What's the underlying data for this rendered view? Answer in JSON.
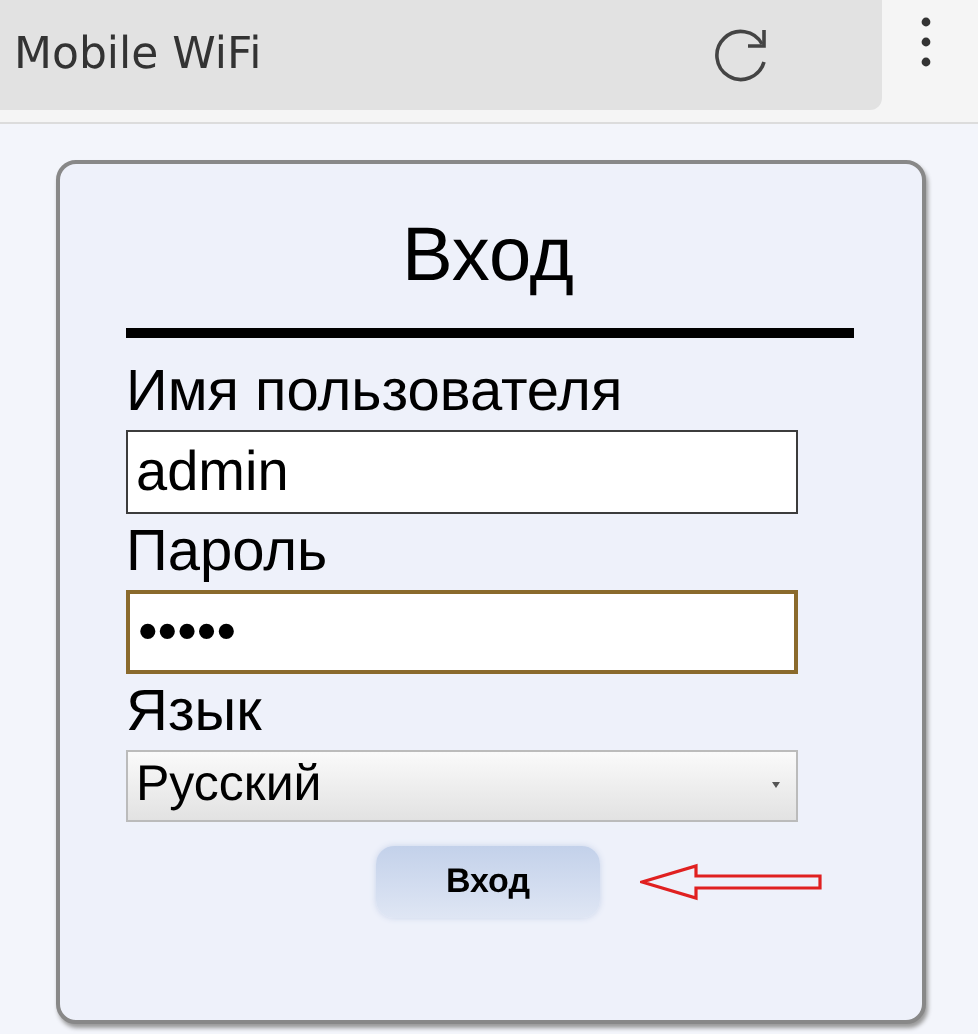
{
  "browser": {
    "address": "Mobile WiFi"
  },
  "login": {
    "title": "Вход",
    "fields": [
      {
        "kind": "text",
        "label": "Имя пользователя",
        "value": "admin",
        "focused": false
      },
      {
        "kind": "text",
        "label": "Пароль",
        "value": "•••••",
        "focused": true
      },
      {
        "kind": "select",
        "label": "Язык",
        "value": "Русский"
      }
    ],
    "button": "Вход"
  }
}
